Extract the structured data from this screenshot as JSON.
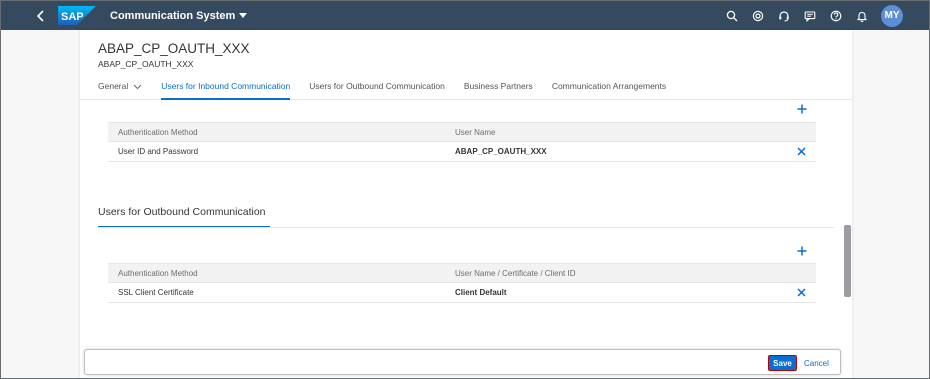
{
  "shell": {
    "logo_text": "SAP",
    "app_title": "Communication System",
    "avatar_initials": "MY"
  },
  "header": {
    "title": "ABAP_CP_OAUTH_XXX",
    "subtitle": "ABAP_CP_OAUTH_XXX"
  },
  "tabs": [
    {
      "label": "General"
    },
    {
      "label": "Users for Inbound Communication"
    },
    {
      "label": "Users for Outbound Communication"
    },
    {
      "label": "Business Partners"
    },
    {
      "label": "Communication Arrangements"
    }
  ],
  "inbound": {
    "columns": [
      "Authentication Method",
      "User Name"
    ],
    "rows": [
      {
        "method": "User ID and Password",
        "user": "ABAP_CP_OAUTH_XXX"
      }
    ]
  },
  "outbound": {
    "section_title": "Users for Outbound Communication",
    "columns": [
      "Authentication Method",
      "User Name / Certificate / Client ID"
    ],
    "rows": [
      {
        "method": "SSL Client Certificate",
        "user": "Client Default"
      }
    ]
  },
  "footer": {
    "save_label": "Save",
    "cancel_label": "Cancel"
  },
  "colors": {
    "shell_bg": "#354a5f",
    "accent": "#0a6ed1",
    "avatar_bg": "#5d8fd6"
  }
}
